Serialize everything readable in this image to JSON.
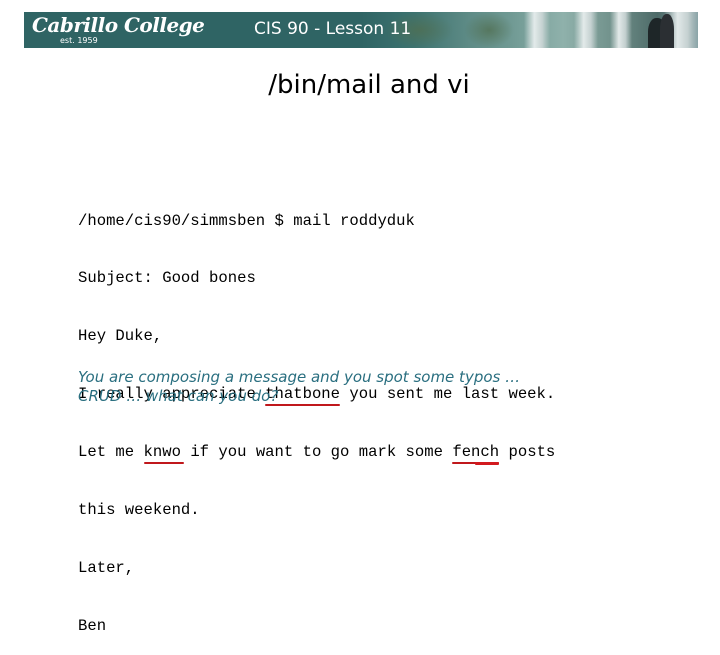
{
  "header": {
    "logo_text": "Cabrillo College",
    "logo_est": "est. 1959",
    "course_title": "CIS 90 - Lesson 11"
  },
  "slide": {
    "title": "/bin/mail and vi"
  },
  "terminal": {
    "lines": [
      "/home/cis90/simmsben $ mail roddyduk",
      "Subject: Good bones",
      "Hey Duke,",
      "I really appreciate thatbone you sent me last week.",
      "Let me knwo if you want to go mark some fench posts",
      "this weekend.",
      "Later,",
      "Ben"
    ],
    "line4_pre": "I really appreciate ",
    "line4_typo": "thatbone",
    "line4_post": " you sent me last week.",
    "line5_pre": "Let me ",
    "line5_typo1": "knwo ",
    "line5_mid": "if you want to go mark some ",
    "line5_typo2": "fench",
    "line5_post": " posts",
    "typo_underline_color": "#c0181c"
  },
  "caption": {
    "line1": "You are composing a message and you spot some typos …",
    "line2": "CRUD … what can you do?",
    "color": "#2a6f80"
  },
  "colors": {
    "banner": "#2f6464",
    "background": "#ffffff"
  }
}
